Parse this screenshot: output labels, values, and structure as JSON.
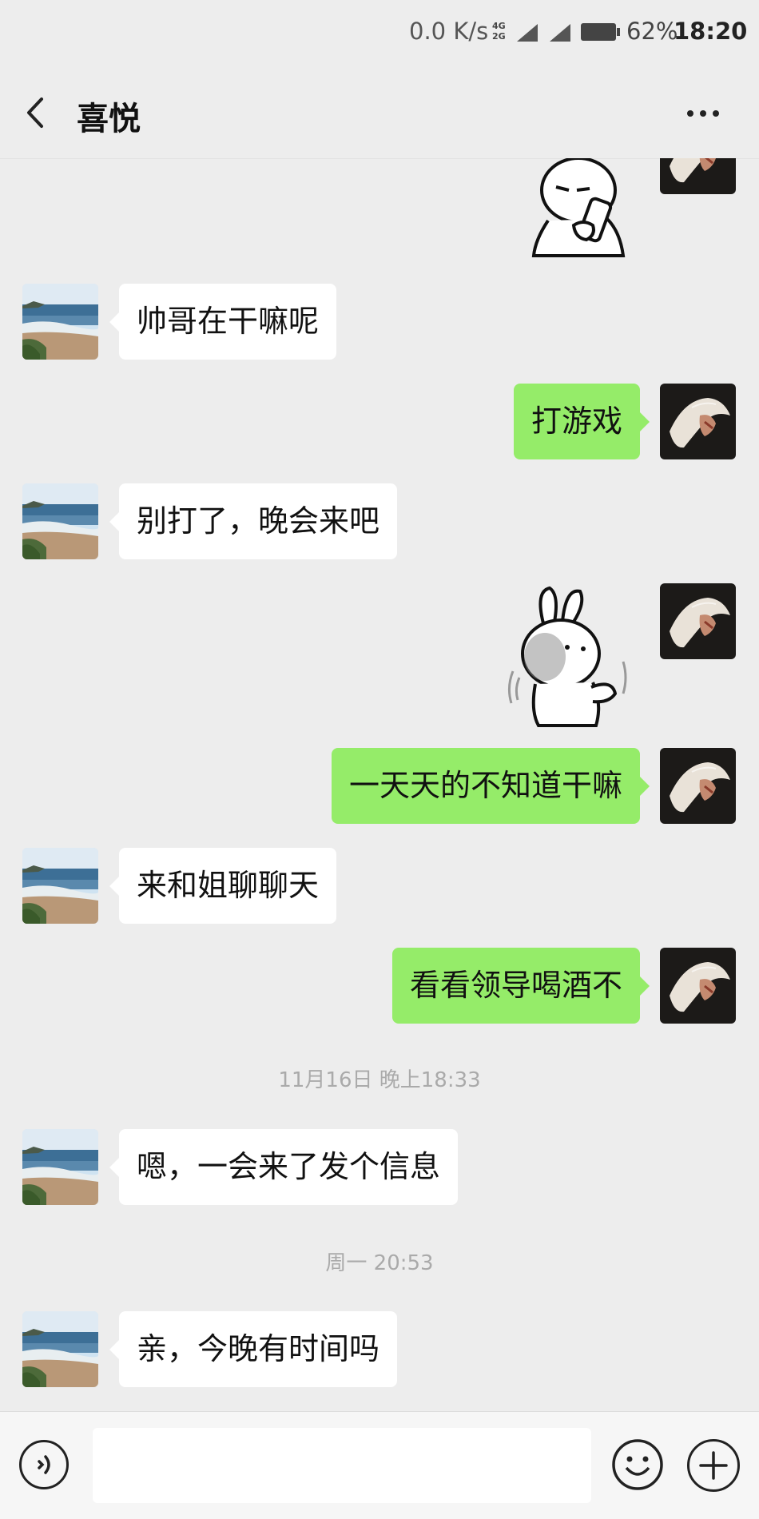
{
  "status_bar": {
    "speed": "0.0 K/s",
    "network_4g": "4G",
    "network_2g": "2G",
    "battery_percent": "62%",
    "time": "18:20"
  },
  "header": {
    "title": "喜悦",
    "back_icon": "chevron-left-icon",
    "more_icon": "more-dots-icon"
  },
  "messages": [
    {
      "type": "sticker",
      "side": "out",
      "sticker": "drinking-rabbit-sticker"
    },
    {
      "type": "text",
      "side": "in",
      "text": "帅哥在干嘛呢"
    },
    {
      "type": "text",
      "side": "out",
      "text": "打游戏"
    },
    {
      "type": "text",
      "side": "in",
      "text": "别打了，晚会来吧"
    },
    {
      "type": "sticker",
      "side": "out",
      "sticker": "waving-rabbit-sticker"
    },
    {
      "type": "text",
      "side": "out",
      "text": "一天天的不知道干嘛"
    },
    {
      "type": "text",
      "side": "in",
      "text": "来和姐聊聊天"
    },
    {
      "type": "text",
      "side": "out",
      "text": "看看领导喝酒不"
    },
    {
      "type": "time",
      "text": "11月16日 晚上18:33"
    },
    {
      "type": "text",
      "side": "in",
      "text": "嗯，一会来了发个信息"
    },
    {
      "type": "time",
      "text": "周一 20:53"
    },
    {
      "type": "text",
      "side": "in",
      "text": "亲，今晚有时间吗"
    }
  ],
  "input_bar": {
    "voice_icon": "voice-icon",
    "input_value": "",
    "emoji_icon": "emoji-icon",
    "plus_icon": "plus-icon"
  },
  "colors": {
    "background": "#ededed",
    "outgoing_bubble": "#95ec69",
    "incoming_bubble": "#ffffff"
  }
}
